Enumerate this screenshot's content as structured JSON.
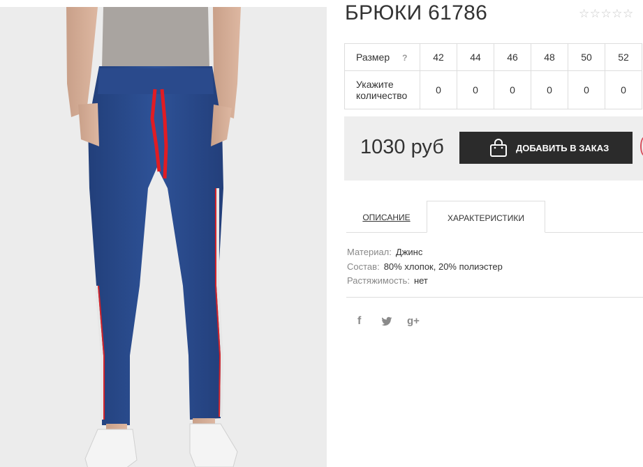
{
  "product": {
    "title": "БРЮКИ 61786",
    "rating_stars": [
      "☆",
      "☆",
      "☆",
      "☆",
      "☆"
    ],
    "image_icon": "product-photo-jeans-trousers"
  },
  "sizes": {
    "size_label": "Размер",
    "help_icon": "?",
    "qty_label_line1": "Укажите",
    "qty_label_line2": "количество",
    "values": [
      "42",
      "44",
      "46",
      "48",
      "50",
      "52"
    ],
    "quantities": [
      "0",
      "0",
      "0",
      "0",
      "0",
      "0"
    ]
  },
  "buy": {
    "price": "1030 руб",
    "add_button_label": "ДОБАВИТЬ В ЗАКАЗ",
    "button_color": "#2b2b2b"
  },
  "tabs": {
    "description": "ОПИСАНИЕ",
    "characteristics": "ХАРАКТЕРИСТИКИ"
  },
  "specs": [
    {
      "key": "Материал:",
      "value": "Джинс"
    },
    {
      "key": "Состав:",
      "value": "80% хлопок, 20% полиэстер"
    },
    {
      "key": "Растяжимость:",
      "value": "нет"
    }
  ],
  "social": {
    "facebook": "f",
    "twitter": "twitter-icon",
    "gplus": "g+"
  }
}
